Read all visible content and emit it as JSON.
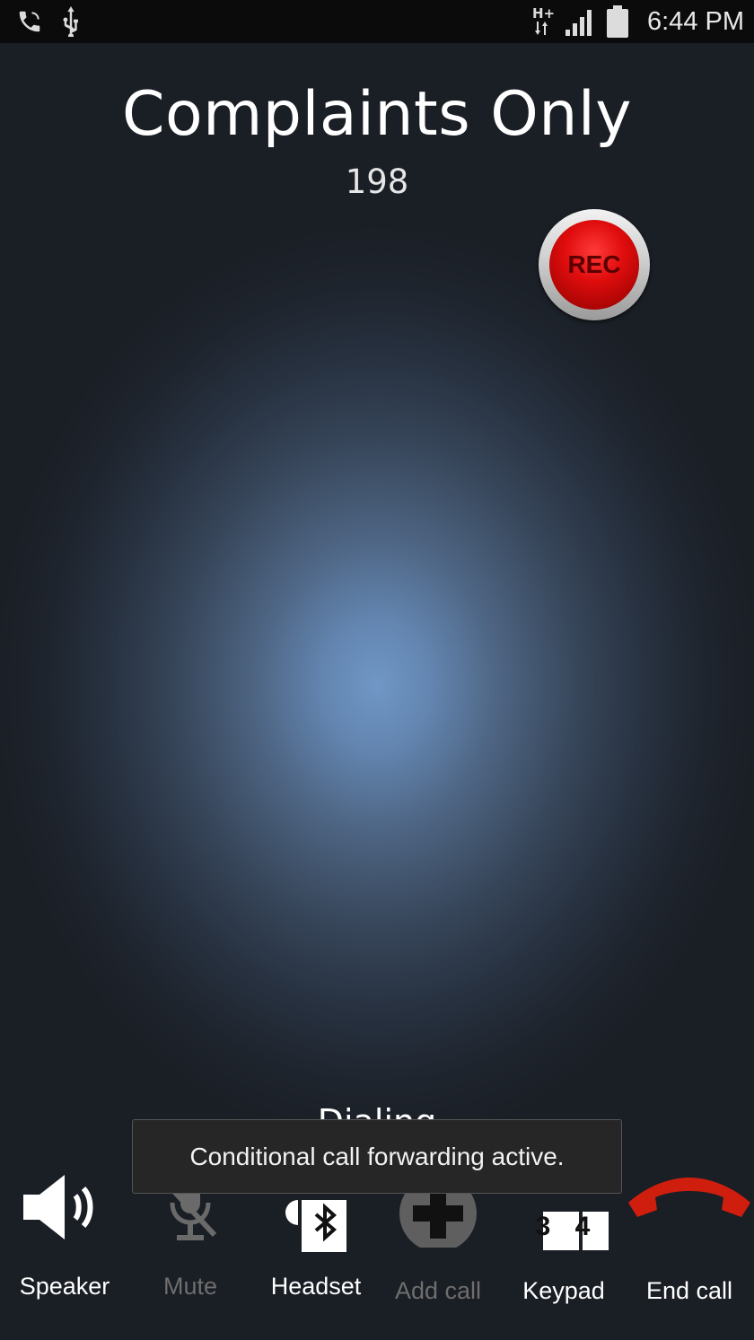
{
  "status_bar": {
    "left_icons": [
      "phone-call-icon",
      "usb-icon"
    ],
    "right_icons": [
      "hspa-plus-data-icon",
      "signal-strength-icon",
      "battery-icon"
    ],
    "time": "6:44 PM"
  },
  "call": {
    "contact_name": "Complaints Only",
    "number": "198",
    "state": "Dialing",
    "record_label": "REC"
  },
  "toast": {
    "message": "Conditional call forwarding active."
  },
  "controls": {
    "speaker": {
      "label": "Speaker",
      "icon": "speaker-icon",
      "enabled": true
    },
    "mute": {
      "label": "Mute",
      "icon": "mute-microphone-icon",
      "enabled": false
    },
    "headset": {
      "label": "Headset",
      "icon": "bluetooth-headset-icon",
      "enabled": true
    },
    "add_call": {
      "label": "Add call",
      "icon": "add-call-icon",
      "enabled": false
    },
    "keypad": {
      "label": "Keypad",
      "icon": "keypad-icon",
      "enabled": true,
      "digits": [
        "3",
        "4"
      ]
    },
    "end_call": {
      "label": "End call",
      "icon": "end-call-icon",
      "enabled": true,
      "color": "#d01e0e"
    }
  }
}
